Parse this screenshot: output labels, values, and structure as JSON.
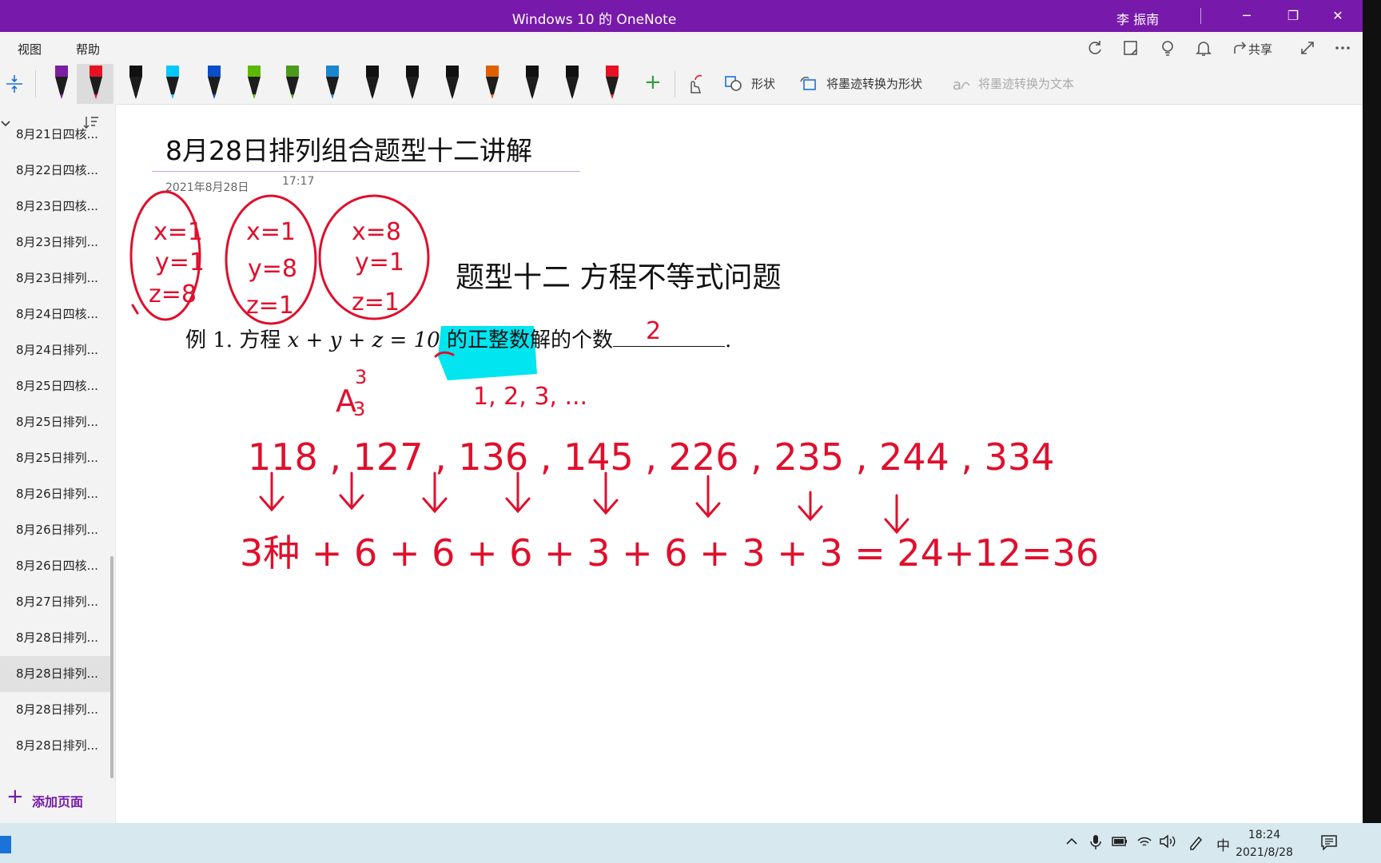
{
  "window": {
    "title": "Windows 10 的 OneNote",
    "user": "李 振南",
    "minimize": "─",
    "restore": "❐",
    "close": "✕"
  },
  "menu": {
    "items": [
      "视图",
      "帮助"
    ],
    "share_label": "共享"
  },
  "ribbon": {
    "shapes_label": "形状",
    "ink_to_shape_label": "将墨迹转换为形状",
    "ink_to_text_label": "将墨迹转换为文本",
    "add_pen": "+",
    "pen_colors": [
      "#7a1fa2",
      "#e81123",
      "#111111",
      "#00c8ff",
      "#0a4ec9",
      "#5cb800",
      "#4b9a1a",
      "#1a86d0",
      "#111111",
      "#111111",
      "#111111",
      "#e06000",
      "#111111",
      "#111111",
      "#e81123"
    ]
  },
  "sidebar": {
    "pages": [
      "8月21日四核...",
      "8月22日四核...",
      "8月23日四核...",
      "8月23日排列...",
      "8月23日排列...",
      "8月24日四核...",
      "8月24日排列...",
      "8月25日四核...",
      "8月25日排列...",
      "8月25日排列...",
      "8月26日排列...",
      "8月26日排列...",
      "8月26日四核...",
      "8月27日排列...",
      "8月28日排列...",
      "8月28日排列...",
      "8月28日排列...",
      "8月28日排列..."
    ],
    "selected_index": 15,
    "add_page_label": "添加页面"
  },
  "page": {
    "title": "8月28日排列组合题型十二讲解",
    "date": "2021年8月28日",
    "time": "17:17",
    "heading": "题型十二  方程不等式问题",
    "example_prefix": "例 1. 方程 ",
    "equation": "x + y + z = 10",
    "example_mid": " 的",
    "highlight_text": "正整数解",
    "example_suffix": "的个数",
    "example_end": "."
  },
  "ink": {
    "circle1": [
      "x=1",
      "y=1",
      "z=8"
    ],
    "circle2": [
      "x=1",
      "y=8",
      "z=1"
    ],
    "circle3": [
      "x=8",
      "y=1",
      "z=1"
    ],
    "answer": "2",
    "a33_base": "A",
    "a33_sub": "3",
    "a33_sup": "3",
    "sequence": "1, 2, 3, ...",
    "triples": "118 , 127 , 136 , 145 , 226 , 235 , 244 , 334",
    "sum": "3种 + 6 + 6 + 6 + 3 + 6 + 3 + 3 = 24+12=36"
  },
  "taskbar": {
    "ime": "中",
    "time": "18:24",
    "date": "2021/8/28"
  }
}
